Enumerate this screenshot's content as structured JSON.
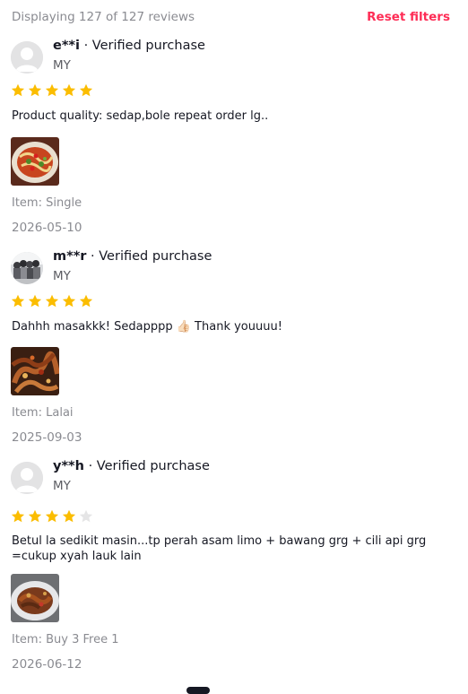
{
  "header": {
    "summary": "Displaying 127 of 127 reviews",
    "reset_label": "Reset filters"
  },
  "reviews": [
    {
      "username": "e**i",
      "badge": "· Verified purchase",
      "country": "MY",
      "rating": 5,
      "max_rating": 5,
      "text": "Product quality: sedap,bole repeat order lg..",
      "item_label": "Item:",
      "item_value": "Single",
      "date": "2026-05-10",
      "avatar": "default-avatar-icon",
      "photo": "food-photo-noodles"
    },
    {
      "username": "m**r",
      "badge": "· Verified purchase",
      "country": "MY",
      "rating": 5,
      "max_rating": 5,
      "text": "Dahhh masakkk! Sedapppp 👍🏻 Thank youuuu!",
      "item_label": "Item:",
      "item_value": "Lalai",
      "date": "2025-09-03",
      "avatar": "photo-avatar",
      "photo": "food-photo-stirfry"
    },
    {
      "username": "y**h",
      "badge": "· Verified purchase",
      "country": "MY",
      "rating": 4,
      "max_rating": 5,
      "text": "Betul la sedikit masin...tp perah asam limo + bawang grg + cili api grg =cukup xyah lauk lain",
      "item_label": "Item:",
      "item_value": "Buy 3 Free 1",
      "date": "2026-06-12",
      "avatar": "default-avatar-icon",
      "photo": "food-photo-plate"
    }
  ],
  "colors": {
    "accent": "#fe2c55",
    "star_filled": "#fbbd00",
    "star_empty": "#e5e5e6",
    "muted_text": "#8a8b91"
  }
}
